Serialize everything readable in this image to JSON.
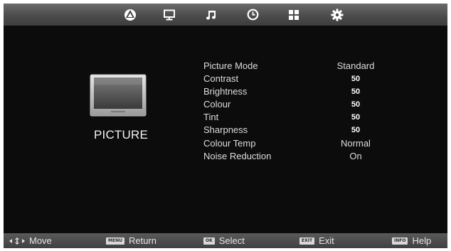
{
  "menu_tabs": [
    {
      "name": "picture",
      "icon": "picture-tab-icon",
      "active": true
    },
    {
      "name": "screen",
      "icon": "monitor-icon"
    },
    {
      "name": "sound",
      "icon": "music-note-icon"
    },
    {
      "name": "time",
      "icon": "clock-icon"
    },
    {
      "name": "lock",
      "icon": "grid-icon"
    },
    {
      "name": "setup",
      "icon": "gear-icon"
    }
  ],
  "section": {
    "title": "PICTURE",
    "icon": "tv-picture-icon"
  },
  "settings": [
    {
      "label": "Picture Mode",
      "value": "Standard"
    },
    {
      "label": "Contrast",
      "value": "50"
    },
    {
      "label": "Brightness",
      "value": "50"
    },
    {
      "label": "Colour",
      "value": "50"
    },
    {
      "label": "Tint",
      "value": "50"
    },
    {
      "label": "Sharpness",
      "value": "50"
    },
    {
      "label": "Colour Temp",
      "value": "Normal"
    },
    {
      "label": "Noise Reduction",
      "value": "On"
    }
  ],
  "footer": {
    "move": {
      "label": "Move",
      "icon": "arrows-icon"
    },
    "return": {
      "key": "MENU",
      "label": "Return"
    },
    "select": {
      "key": "OK",
      "label": "Select"
    },
    "exit": {
      "key": "EXIT",
      "label": "Exit"
    },
    "help": {
      "key": "INFO",
      "label": "Help"
    }
  },
  "colors": {
    "background": "#0c0c0c",
    "bar": "#4a4a4a",
    "text": "#dddddd"
  }
}
